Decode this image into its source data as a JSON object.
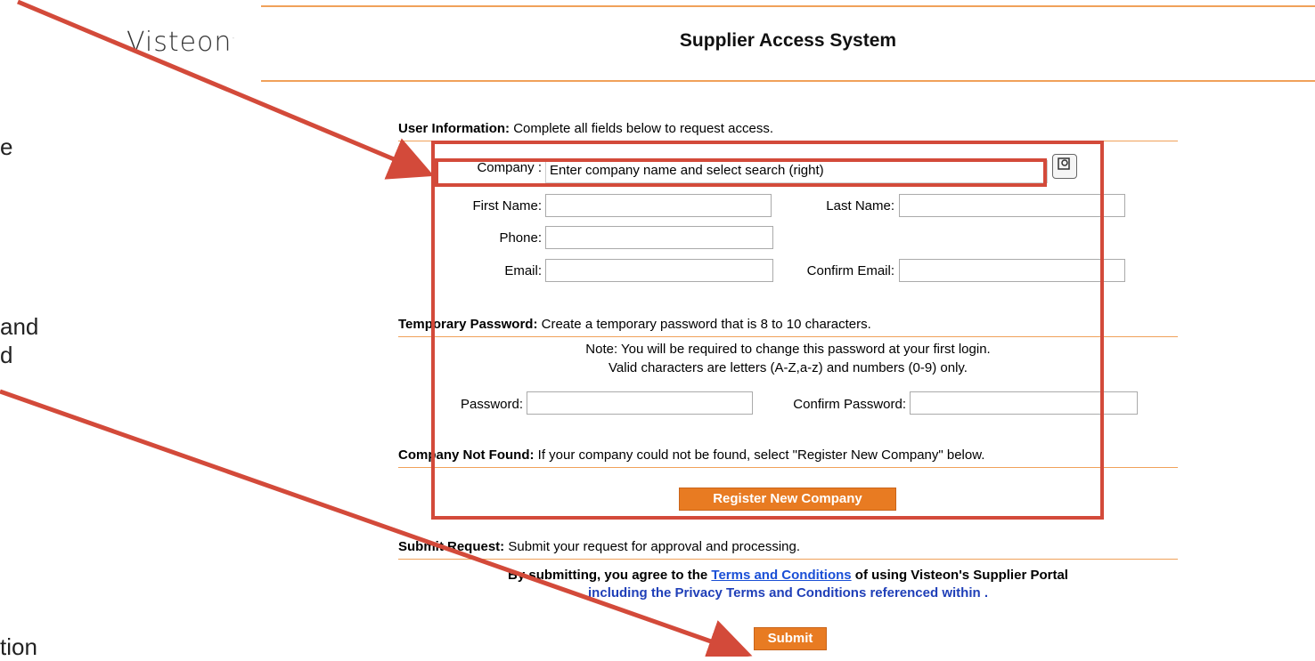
{
  "side_fragments": [
    "e",
    "and",
    "d",
    "tion"
  ],
  "header": {
    "logo": "Visteon",
    "logo_mark": "·",
    "title": "Supplier Access System"
  },
  "user_info": {
    "heading": "User Information:",
    "text": "Complete all fields below to request access.",
    "company_label": "Company :",
    "company_value": "Enter company name and select search (right)",
    "first_name_label": "First Name:",
    "last_name_label": "Last Name:",
    "phone_label": "Phone:",
    "email_label": "Email:",
    "confirm_email_label": "Confirm Email:"
  },
  "temp_password": {
    "heading": "Temporary Password:",
    "text": "Create a temporary password that is 8 to 10 characters.",
    "note_line1": "Note: You will be required to change this password at your first login.",
    "note_line2": "Valid characters are letters (A-Z,a-z) and numbers (0-9) only.",
    "password_label": "Password:",
    "confirm_password_label": "Confirm Password:"
  },
  "company_not_found": {
    "heading": "Company Not Found:",
    "text": "If your company could not be found, select \"Register New Company\" below.",
    "register_button": "Register New Company"
  },
  "submit": {
    "heading": "Submit Request:",
    "text": "Submit your request for approval and processing.",
    "agree_prefix": "By submitting, you agree to the",
    "terms_link": "Terms and Conditions",
    "agree_suffix": "of using Visteon's Supplier Portal",
    "agree_line2": "including the Privacy Terms and Conditions referenced within .",
    "submit_button": "Submit"
  },
  "colors": {
    "accent": "#e87b22",
    "rule": "#f0a15a",
    "annotation": "#d34a3a",
    "link": "#1a4fd6"
  }
}
